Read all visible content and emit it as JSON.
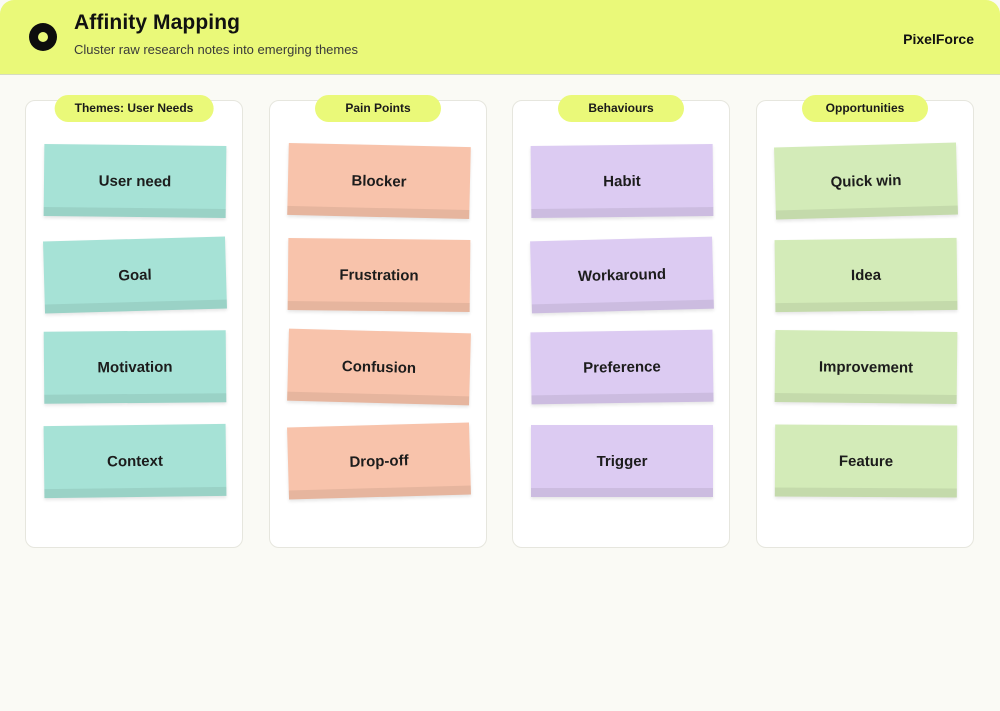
{
  "header": {
    "title": "Affinity Mapping",
    "subtitle": "Cluster raw research notes into emerging themes",
    "brand": "PixelForce",
    "logo_icon": "ring-logo-icon",
    "background_color": "#eaf979"
  },
  "columns": [
    {
      "title": "Themes: User Needs",
      "note_color": "#a6e2d6",
      "notes": [
        "User need",
        "Goal",
        "Motivation",
        "Context"
      ]
    },
    {
      "title": "Pain Points",
      "note_color": "#f8c3ab",
      "notes": [
        "Blocker",
        "Frustration",
        "Confusion",
        "Drop-off"
      ]
    },
    {
      "title": "Behaviours",
      "note_color": "#dccbf2",
      "notes": [
        "Habit",
        "Workaround",
        "Preference",
        "Trigger"
      ]
    },
    {
      "title": "Opportunities",
      "note_color": "#d3ebb8",
      "notes": [
        "Quick win",
        "Idea",
        "Improvement",
        "Feature"
      ]
    }
  ]
}
